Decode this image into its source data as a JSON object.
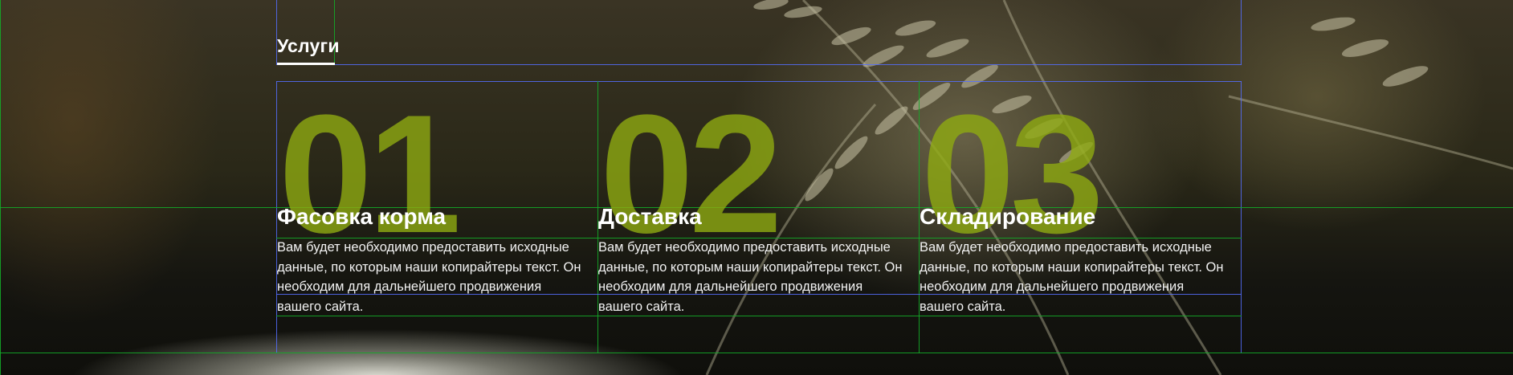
{
  "section": {
    "title": "Услуги"
  },
  "services": [
    {
      "number": "01",
      "title": "Фасовка корма",
      "text": "Вам будет необходимо предоставить исходные данные, по которым наши копирайтеры текст. Он необходим для дальнейшего продвижения вашего сайта."
    },
    {
      "number": "02",
      "title": "Доставка",
      "text": "Вам будет необходимо предоставить исходные данные, по которым наши копирайтеры текст. Он необходим для дальнейшего продвижения вашего сайта."
    },
    {
      "number": "03",
      "title": "Складирование",
      "text": "Вам будет необходимо предоставить исходные данные, по которым наши копирайтеры текст. Он необходим для дальнейшего продвижения вашего сайта."
    }
  ],
  "colors": {
    "number_accent": "#8eaa12",
    "text": "#ffffff",
    "guide_blue": "#556eff",
    "guide_green": "#14aa28"
  }
}
